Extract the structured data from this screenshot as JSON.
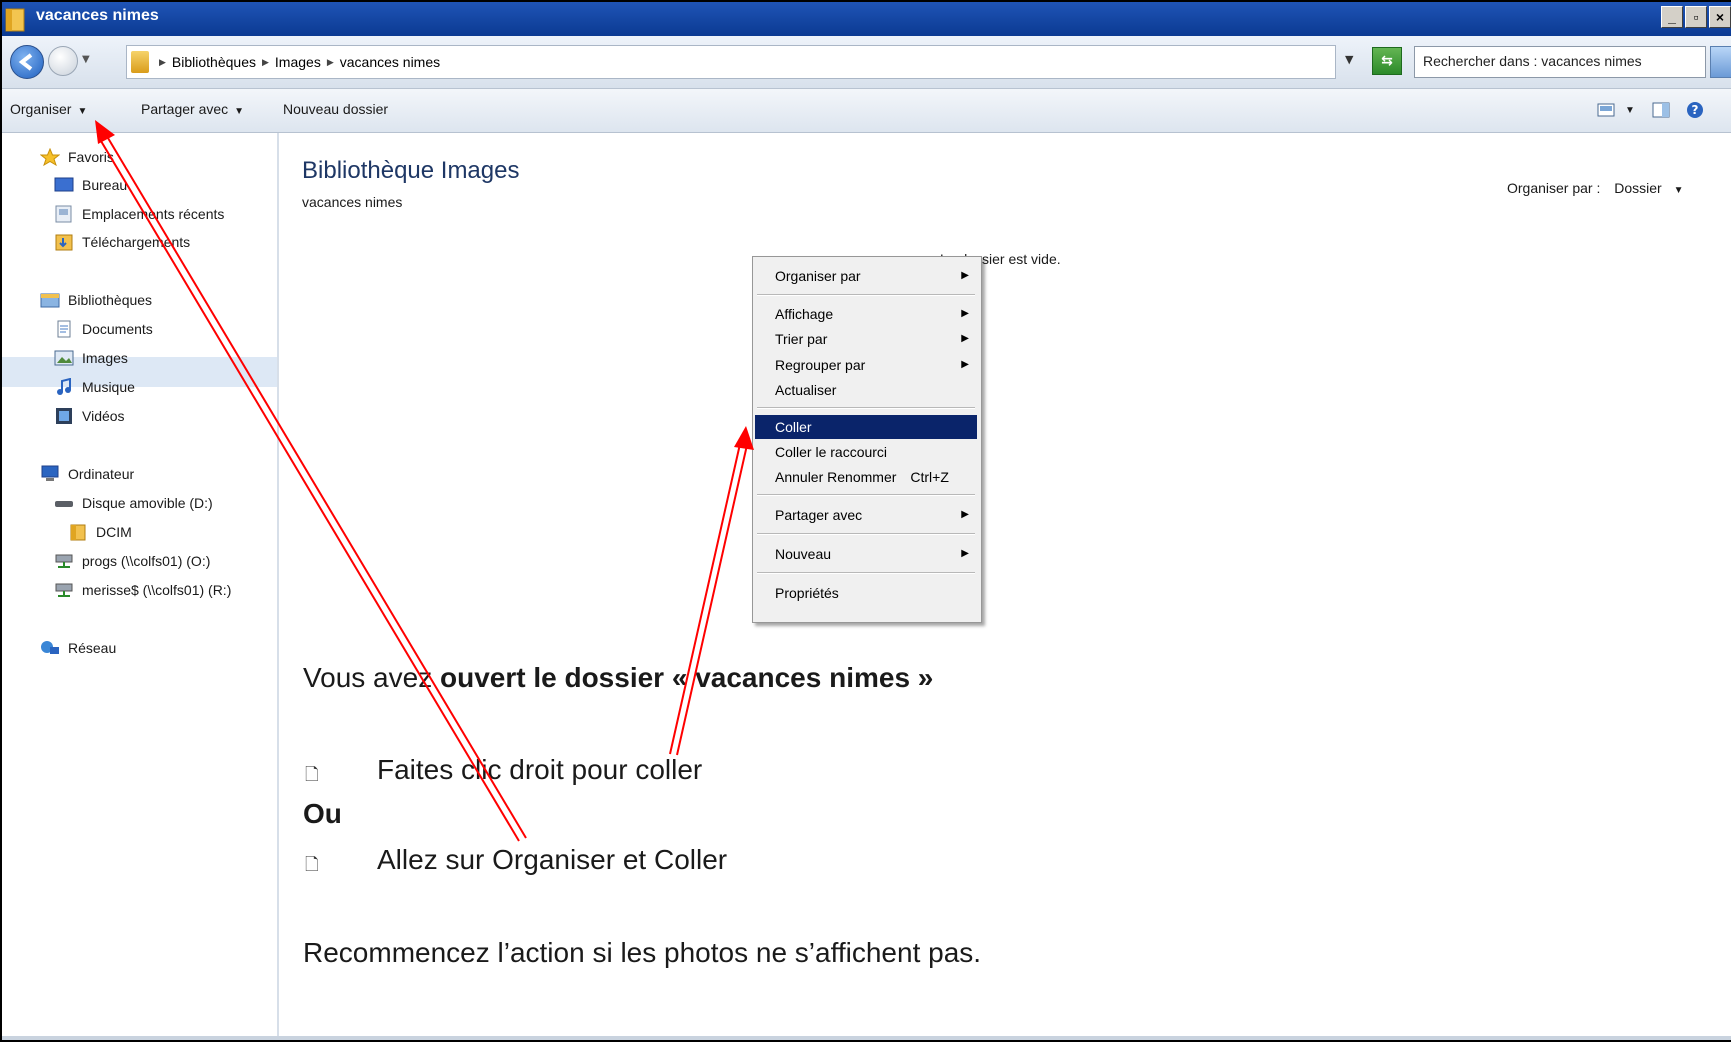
{
  "window": {
    "title": "vacances nimes",
    "buttons": [
      "_",
      "▫",
      "×"
    ]
  },
  "address": {
    "crumbs": [
      "Bibliothèques",
      "Images",
      "vacances nimes"
    ],
    "search_placeholder": "Rechercher dans : vacances nimes"
  },
  "toolbar": {
    "organiser": "Organiser",
    "partager": "Partager avec",
    "nouveau": "Nouveau dossier"
  },
  "sidebar": {
    "favoris": "Favoris",
    "bureau": "Bureau",
    "recents": "Emplacements récents",
    "telechargements": "Téléchargements",
    "bibliotheques": "Bibliothèques",
    "documents": "Documents",
    "images": "Images",
    "musique": "Musique",
    "videos": "Vidéos",
    "ordinateur": "Ordinateur",
    "disque": "Disque amovible (D:)",
    "dcim": "DCIM",
    "progs": "progs (\\\\colfs01) (O:)",
    "merisse": "merisse$ (\\\\colfs01) (R:)",
    "reseau": "Réseau"
  },
  "content": {
    "title": "Bibliothèque Images",
    "subtitle": "vacances nimes",
    "arrange_label": "Organiser par :",
    "arrange_value": "Dossier",
    "empty": "Le dossier est vide."
  },
  "menu": {
    "organiser_par": "Organiser par",
    "affichage": "Affichage",
    "trier_par": "Trier par",
    "regrouper_par": "Regrouper par",
    "actualiser": "Actualiser",
    "coller": "Coller",
    "coller_raccourci": "Coller le raccourci",
    "annuler": "Annuler Renommer",
    "annuler_shortcut": "Ctrl+Z",
    "partager_avec": "Partager avec",
    "nouveau": "Nouveau",
    "proprietes": "Propriétés"
  },
  "notes": {
    "line1_a": "Vous avez ",
    "line1_b": "ouvert le dossier « vacances nimes »",
    "line2": "Faites clic droit pour coller",
    "line3": "Ou",
    "line4": "Allez sur Organiser et Coller",
    "line5": "Recommencez l’action si les photos ne s’affichent pas."
  },
  "colors": {
    "arrow": "#ff0000",
    "menu_highlight": "#0a246a",
    "title_accent": "#1e3765"
  }
}
